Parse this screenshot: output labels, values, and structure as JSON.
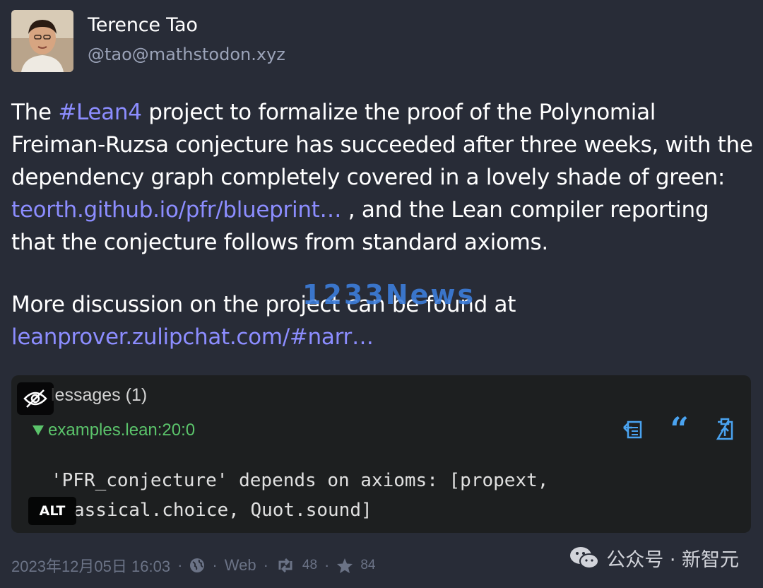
{
  "header": {
    "display_name": "Terence Tao",
    "handle": "@tao@mathstodon.xyz"
  },
  "status": {
    "p1_before_tag": "The ",
    "hashtag": "#Lean4",
    "p1_after_tag": " project to formalize the proof of the Polynomial Freiman-Ruzsa conjecture has succeeded after three weeks, with the dependency graph completely covered in a lovely shade of green: ",
    "link1": "teorth.github.io/pfr/blueprint…",
    "p1_end": " , and the Lean compiler reporting that the conjecture follows from standard axioms.",
    "p2_text": "More discussion on the project can be found at",
    "link2": "leanprover.zulipchat.com/#narr…"
  },
  "watermark": "1233News",
  "media": {
    "messages_header": "lessages (1)",
    "file_label": "examples.lean:20:0",
    "code_line1": "'PFR_conjecture' depends on axioms: [propext,",
    "code_line2": "assical.choice, Quot.sound]",
    "alt_badge": "ALT",
    "icons": [
      "copy-icon",
      "quote-icon",
      "pin-icon"
    ],
    "hide_icon": "eye-slash-icon"
  },
  "footer": {
    "timestamp": "2023年12月05日 16:03",
    "visibility_icon": "globe-icon",
    "application": "Web",
    "boosts": "48",
    "favourites": "84"
  },
  "wechat_watermark": {
    "text": "公众号 · 新智元",
    "icon": "wechat-icon"
  },
  "colors": {
    "background": "#282c37",
    "link": "#8c8dff",
    "muted": "#9ba3b8",
    "code_bg": "#1d1f20",
    "lean_green": "#5bc46b",
    "accent_blue": "#4aa3f0"
  }
}
